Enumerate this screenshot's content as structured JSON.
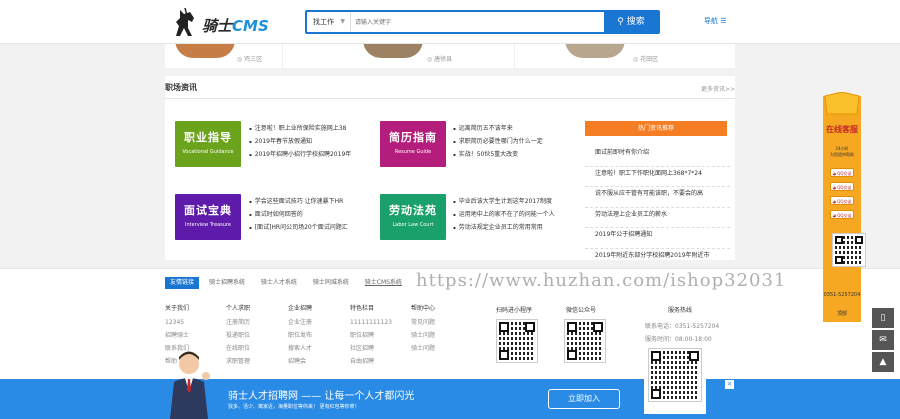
{
  "header": {
    "logo_text_a": "骑士",
    "logo_text_b": "CMS",
    "search_type": "找工作",
    "search_placeholder": "请输入关键字",
    "search_button": "搜索",
    "nav_label": "导航"
  },
  "top_cards": [
    {
      "loc": "鸡三区"
    },
    {
      "loc": "唐徐县"
    },
    {
      "loc": "花田区"
    }
  ],
  "news": {
    "title": "职场资讯",
    "more": "更多资讯>>",
    "tiles": [
      {
        "main": "职业指导",
        "sub": "Vocational Guidance",
        "color": "#6ba31d"
      },
      {
        "main": "简历指南",
        "sub": "Resume Guide",
        "color": "#b31d7c"
      },
      {
        "main": "面试宝典",
        "sub": "Interview Treasure",
        "color": "#5e1aa8"
      },
      {
        "main": "劳动法苑",
        "sub": "Labor Law Court",
        "color": "#1aa06a"
      }
    ],
    "list1": [
      "注意啦！职上业所保险实施网上38",
      "2019年春节放假通知",
      "2019年招聘小招行学校招聘2019年"
    ],
    "list2": [
      "远离简历五不该年来",
      "求职简历必要性哪门为什么一定",
      "实战！50伙5重大改变"
    ],
    "list3": [
      "学会这些面试技巧 让你速暴下HR",
      "面试时如何回答的",
      "[面试]HR问公司场20个面试问题汇"
    ],
    "list4": [
      "毕业后该大学生计划这年2017制度",
      "运用地中上的家不在了的问能一个人",
      "劳动法规定企业员工的常用常用"
    ],
    "hot_title": "热门资讯推荐",
    "hot_list": [
      "面试前即时有你介绍",
      "注意啦！职工下作职化面网上368*7*24",
      "说不服从应干管有可能该职，不要会的高",
      "劳动法理上企业员工的薪水",
      "2019年公于招聘通知",
      "2019年附近东部分学校招聘2019年附近市"
    ]
  },
  "footer": {
    "links_label": "友情链接",
    "links": [
      "骑士招聘系统",
      "骑士人才系统",
      "骑士同城系统",
      "骑士CMS系统"
    ],
    "cols": [
      {
        "h": "关于我们",
        "items": [
          "12345",
          "招聘骑士",
          "联系我们",
          "帮助"
        ]
      },
      {
        "h": "个人求职",
        "items": [
          "注册简历",
          "投递职位",
          "在线职位",
          "求职管理"
        ]
      },
      {
        "h": "企业招聘",
        "items": [
          "企业注册",
          "职位发布",
          "搜索人才",
          "招聘会"
        ]
      },
      {
        "h": "特色栏目",
        "items": [
          "11111111123",
          "职位招聘",
          "社区招聘",
          "自由招聘"
        ]
      },
      {
        "h": "帮助中心",
        "items": [
          "常见问题",
          "骑士问题",
          "骑士问题"
        ]
      }
    ],
    "mini_label": "扫码进小程序",
    "wechat_label": "微信公众号",
    "service_title": "服务热线",
    "service_phone": "联系电话：0351-5257204",
    "service_hours": "服务时间：08:00-18:00"
  },
  "watermark": "https://www.huzhan.com/ishop32031",
  "side": {
    "title": "在线客服",
    "sub1": "24小时",
    "sub2": "为您提供帮助",
    "qq_label": "QQ交谈",
    "phone": "0351-5257204",
    "top": "顶部"
  },
  "banner": {
    "title": "骑士人才招聘网 —— 让每一个人才都闪光",
    "sub": "找多、活少、离家近，海量职位等你来！ 更有红包等你拿！",
    "join": "立即加入",
    "close": "×",
    "qr_text": "扫一扫手机端找工作"
  }
}
